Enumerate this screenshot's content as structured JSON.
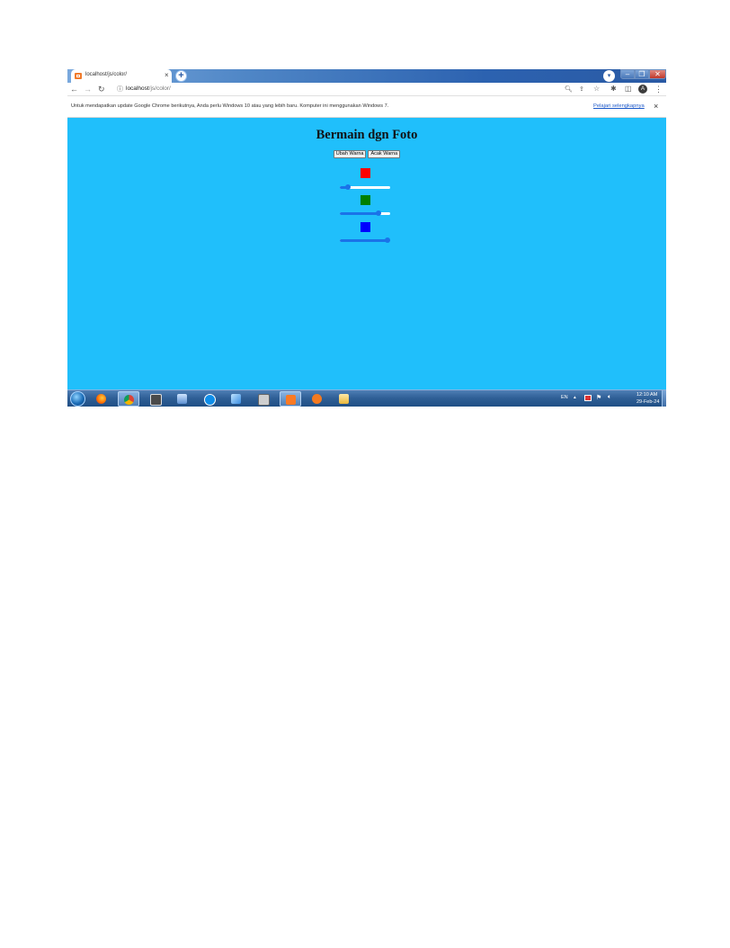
{
  "browser": {
    "tab_title": "localhost/js/color/",
    "tab_close": "×",
    "new_tab": "+",
    "url_host": "localhost",
    "url_path": "/js/color/"
  },
  "infobar": {
    "message": "Untuk mendapatkan update Google Chrome berikutnya, Anda perlu Windows 10 atau yang lebih baru. Komputer ini menggunakan Windows 7.",
    "link": "Pelajari selengkapnya",
    "close": "×"
  },
  "page": {
    "title": "Bermain dgn Foto",
    "buttons": [
      "Ubah Warna",
      "Acak Warna"
    ],
    "colors": {
      "red": "#ff0000",
      "green": "#008000",
      "blue": "#0000ff",
      "background": "#20bffb",
      "slider_accent": "#1a73e8"
    },
    "sliders": {
      "red": 0.16,
      "green": 0.76,
      "blue": 1.0
    }
  },
  "taskbar": {
    "apps": [
      "firefox-icon",
      "chrome-icon",
      "app-icon",
      "network-icon",
      "teamviewer-icon",
      "notepad-icon",
      "keyboard-icon",
      "xampp-icon",
      "media-player-icon",
      "file-explorer-icon"
    ],
    "tray": {
      "language": "EN",
      "time": "12:10 AM",
      "date": "29-Feb-24"
    }
  }
}
